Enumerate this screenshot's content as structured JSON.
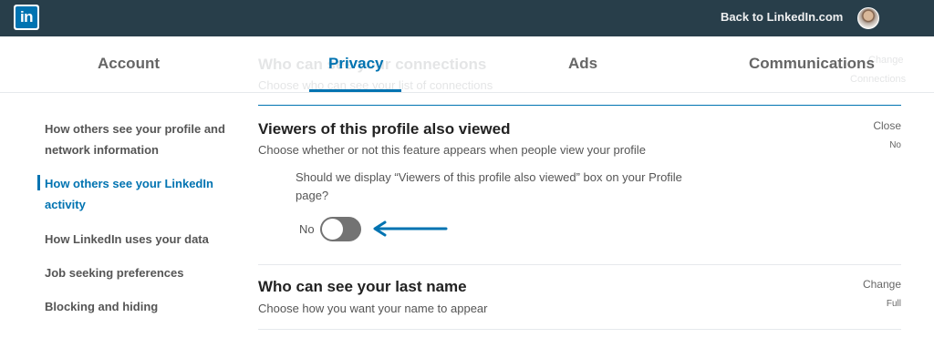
{
  "topbar": {
    "logo_text": "in",
    "back_link": "Back to LinkedIn.com"
  },
  "background_section": {
    "title": "Who can see your connections",
    "desc": "Choose who can see your list of connections",
    "action": "Change",
    "value": "Connections"
  },
  "tabs": [
    {
      "label": "Account"
    },
    {
      "label": "Privacy",
      "active": true
    },
    {
      "label": "Ads"
    },
    {
      "label": "Communications"
    }
  ],
  "sidebar": {
    "items": [
      {
        "label": "How others see your profile and network information"
      },
      {
        "label": "How others see your LinkedIn activity",
        "active": true
      },
      {
        "label": "How LinkedIn uses your data"
      },
      {
        "label": "Job seeking preferences"
      },
      {
        "label": "Blocking and hiding"
      }
    ]
  },
  "viewers_section": {
    "title": "Viewers of this profile also viewed",
    "desc": "Choose whether or not this feature appears when people view your profile",
    "action": "Close",
    "value": "No",
    "question": "Should we display “Viewers of this profile also viewed” box on your Profile page?",
    "toggle_label": "No",
    "toggle_on": false
  },
  "lastname_section": {
    "title": "Who can see your last name",
    "desc": "Choose how you want your name to appear",
    "action": "Change",
    "value": "Full"
  },
  "colors": {
    "topbar": "#283e4a",
    "accent": "#0073b1",
    "toggle_off": "#737373"
  },
  "icons": {
    "logo": "linkedin-logo",
    "arrow": "arrow-left-icon"
  }
}
